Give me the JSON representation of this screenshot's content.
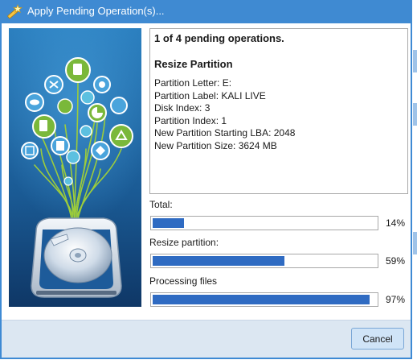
{
  "window": {
    "title": "Apply Pending Operation(s)...",
    "icon": "wand-icon"
  },
  "operation": {
    "heading": "1 of 4 pending operations.",
    "name": "Resize Partition",
    "details": [
      "Partition Letter: E:",
      "Partition Label: KALI LIVE",
      "Disk Index: 3",
      "Partition Index: 1",
      "New Partition Starting LBA: 2048",
      "New Partition Size: 3624 MB"
    ]
  },
  "progress": [
    {
      "label": "Total:",
      "percent_text": "14%",
      "fraction": 0.14
    },
    {
      "label": "Resize partition:",
      "percent_text": "59%",
      "fraction": 0.59
    },
    {
      "label": "Processing files",
      "percent_text": "97%",
      "fraction": 0.97
    }
  ],
  "footer": {
    "cancel_label": "Cancel"
  },
  "colors": {
    "titlebar": "#3f8ad2",
    "progress_fill": "#2f6bc2",
    "footer": "#dce7f2",
    "art_gradient_top": "#2b7fbf",
    "art_gradient_bottom": "#0f3766"
  }
}
